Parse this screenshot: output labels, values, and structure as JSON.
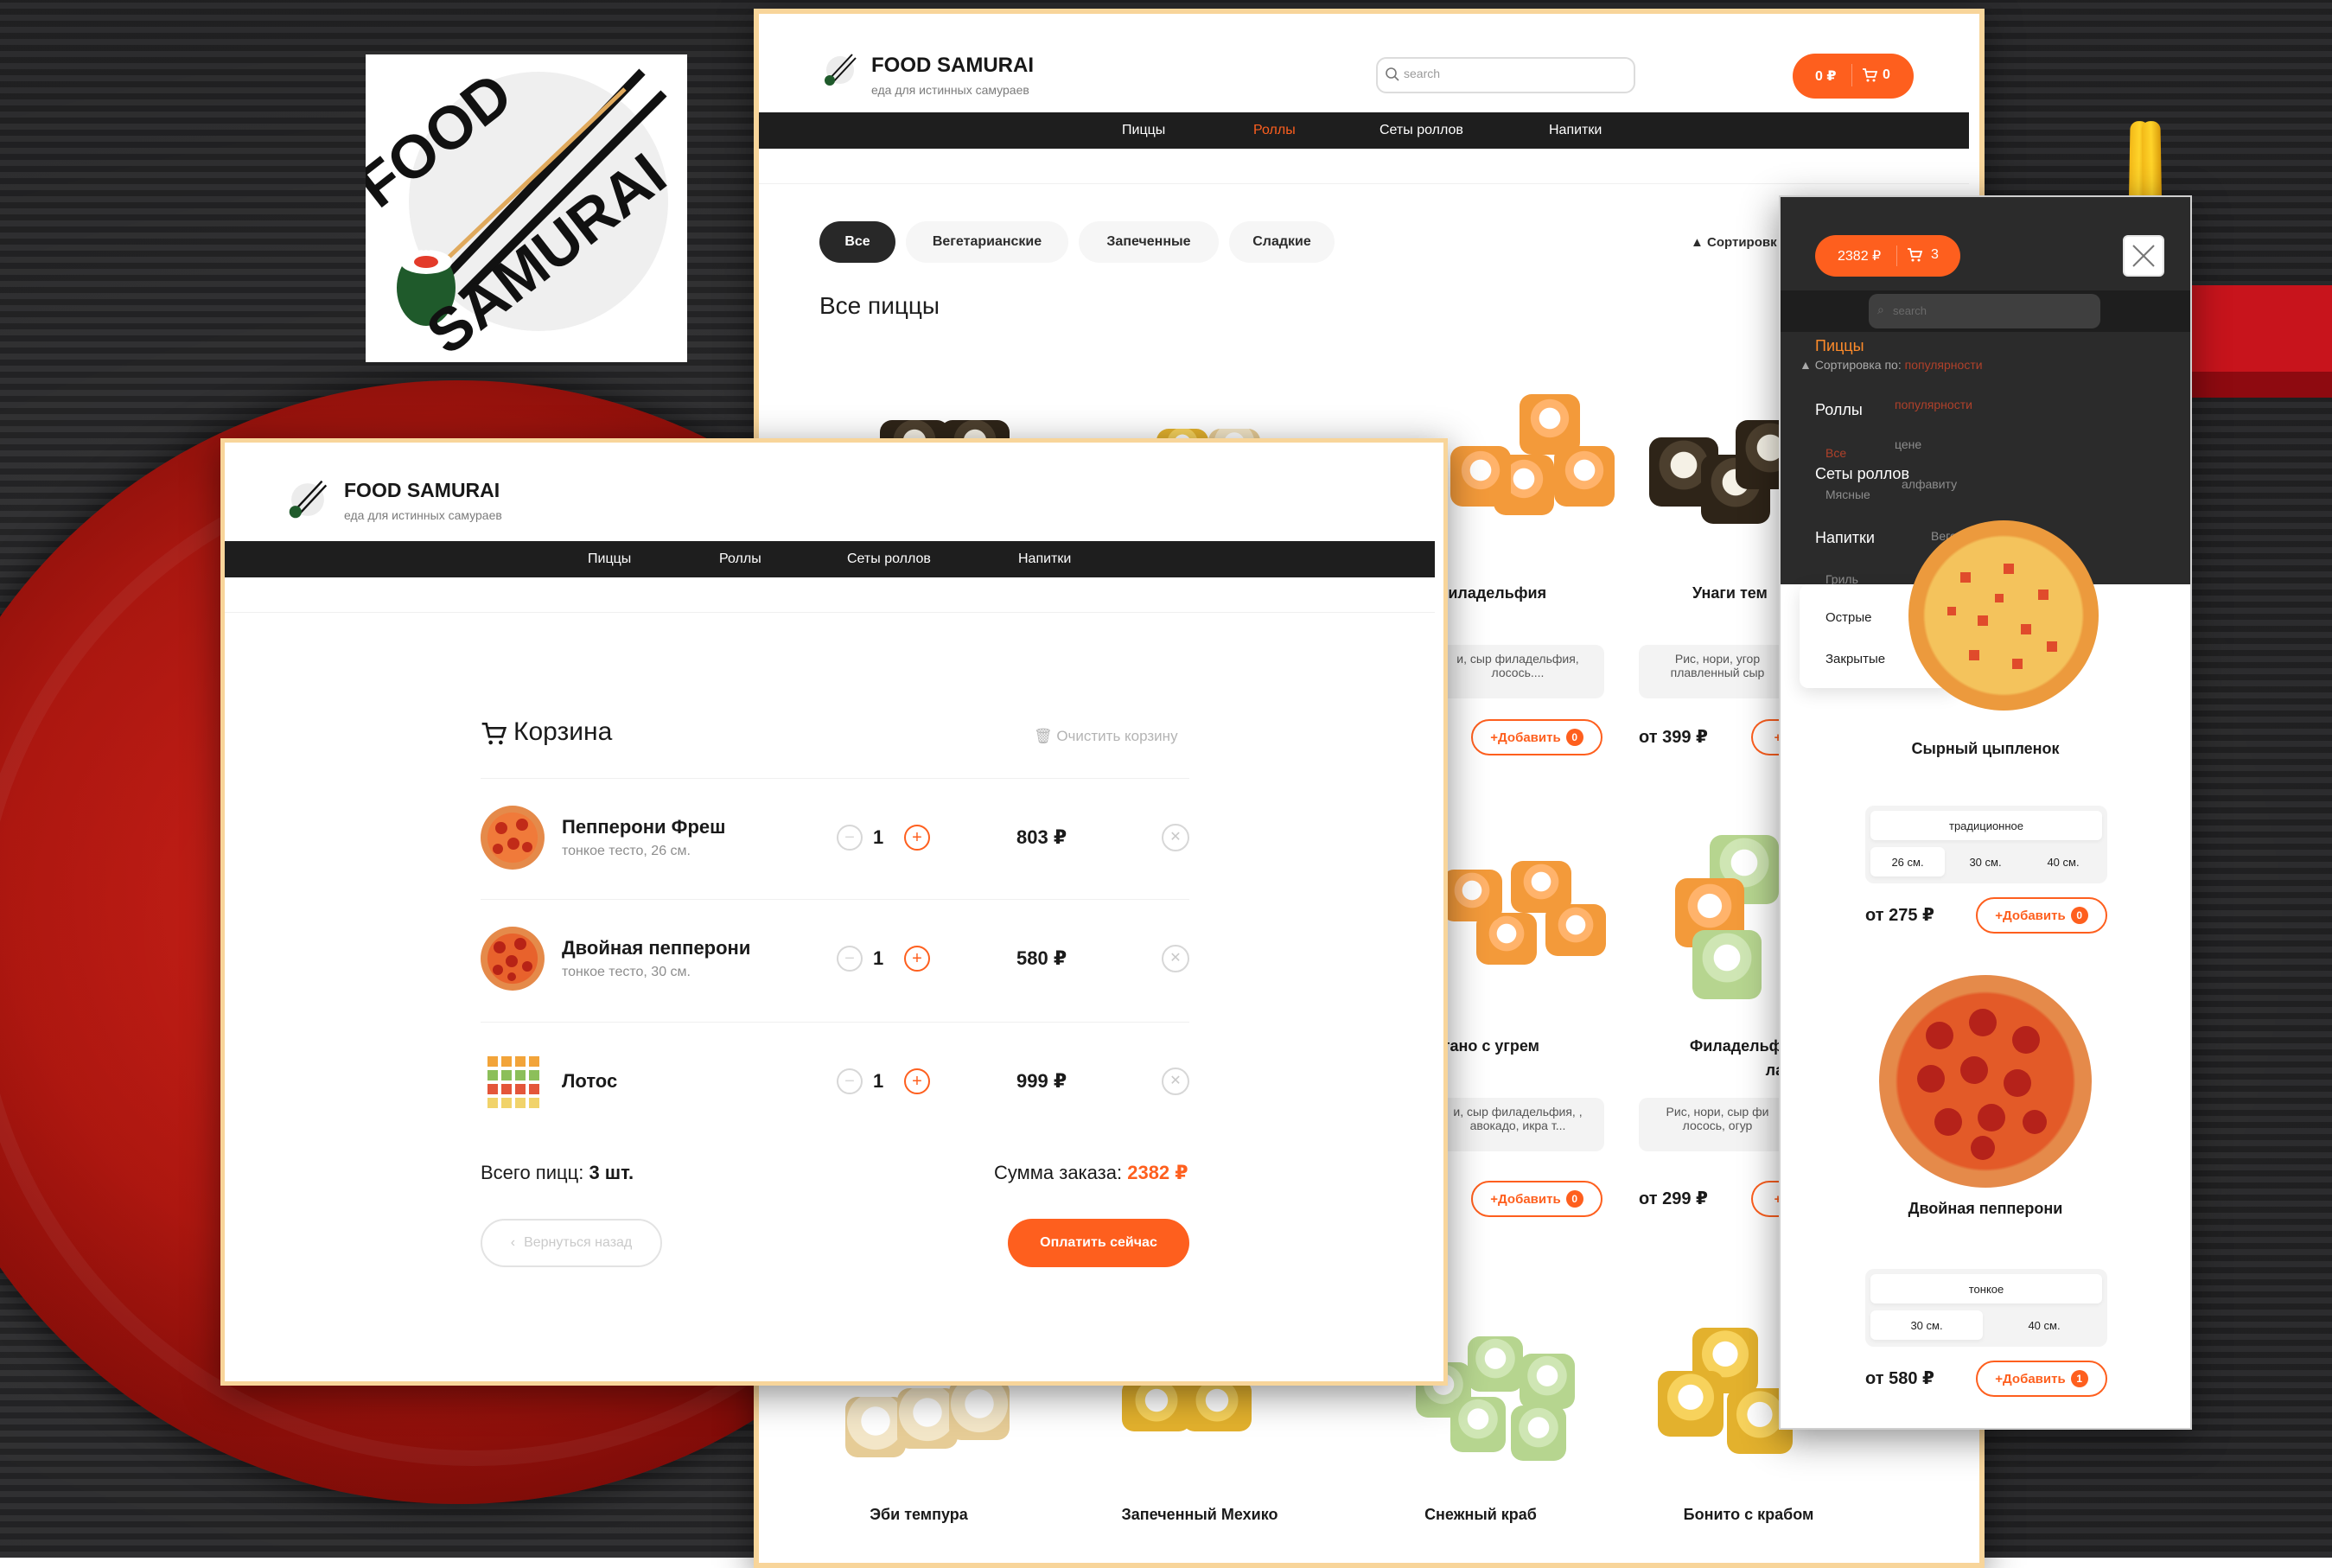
{
  "brand": {
    "name": "FOOD SAMURAI",
    "tagline": "еда для истинных самураев",
    "logo_word1": "FOOD",
    "logo_word2": "SAMURAI"
  },
  "nav": [
    "Пиццы",
    "Роллы",
    "Сеты роллов",
    "Напитки"
  ],
  "catalog": {
    "search_placeholder": "search",
    "cart_total": "0 ₽",
    "cart_count": "0",
    "categories": [
      "Все",
      "Вегетарианские",
      "Запеченные",
      "Сладкие"
    ],
    "sort_label": "Сортировк",
    "section_title": "Все пиццы",
    "products_row1": [
      {
        "name": "Филадельфия",
        "desc": "и, сыр филадельфия, лосось....",
        "add": "Добавить",
        "badge": "0"
      },
      {
        "name": "Унаги тем",
        "desc": "Рис, нори, угор плавленный сыр",
        "price": "от 399 ₽"
      }
    ],
    "products_row2": [
      {
        "name": "гано с угрем",
        "desc": "и, сыр филадельфия, , авокадо, икра т...",
        "add": "Добавить",
        "badge": "0"
      },
      {
        "name_l1": "Филадельфия",
        "name_l2": "лайт",
        "desc": "Рис, нори, сыр фи лосось, огур",
        "price": "от 299 ₽"
      }
    ],
    "products_row3": [
      "Эби темпура",
      "Запеченный Мехико",
      "Снежный краб",
      "Бонито с крабом"
    ]
  },
  "cart": {
    "title": "Корзина",
    "clear_label": "Очистить корзину",
    "items": [
      {
        "name": "Пепперони Фреш",
        "sub": "тонкое тесто, 26 см.",
        "qty": "1",
        "price": "803 ₽"
      },
      {
        "name": "Двойная пепперони",
        "sub": "тонкое тесто, 30 см.",
        "qty": "1",
        "price": "580 ₽"
      },
      {
        "name": "Лотос",
        "sub": "",
        "qty": "1",
        "price": "999 ₽"
      }
    ],
    "total_count_label": "Всего пицц:",
    "total_count_value": "3 шт.",
    "sum_label": "Сумма заказа:",
    "sum_value": "2382 ₽",
    "back_label": "Вернуться назад",
    "pay_label": "Оплатить сейчас"
  },
  "mobile": {
    "cart_total": "2382 ₽",
    "cart_count": "3",
    "search_placeholder": "search",
    "sort_label": "Сортировка по:",
    "sort_value": "популярности",
    "sort_options": [
      "популярности",
      "цене",
      "алфавиту"
    ],
    "cat_ghost": [
      "Все",
      "Мясные",
      "Вегетарианская",
      "Гриль"
    ],
    "cat_items": [
      "Острые",
      "Закрытые"
    ],
    "products": [
      {
        "name": "Сырный цыпленок",
        "dough": [
          "традиционное"
        ],
        "sizes": [
          "26 см.",
          "30 см.",
          "40 см."
        ],
        "price": "от 275 ₽",
        "add": "Добавить",
        "badge": "0"
      },
      {
        "name": "Двойная пепперони",
        "dough": [
          "тонкое"
        ],
        "sizes": [
          "30 см.",
          "40 см."
        ],
        "price": "от 580 ₽",
        "add": "Добавить",
        "badge": "1"
      }
    ]
  },
  "colors": {
    "accent": "#fe5f1e",
    "dark": "#1e1e1e",
    "frame": "#f8d59a",
    "plate": "#c21a12"
  }
}
